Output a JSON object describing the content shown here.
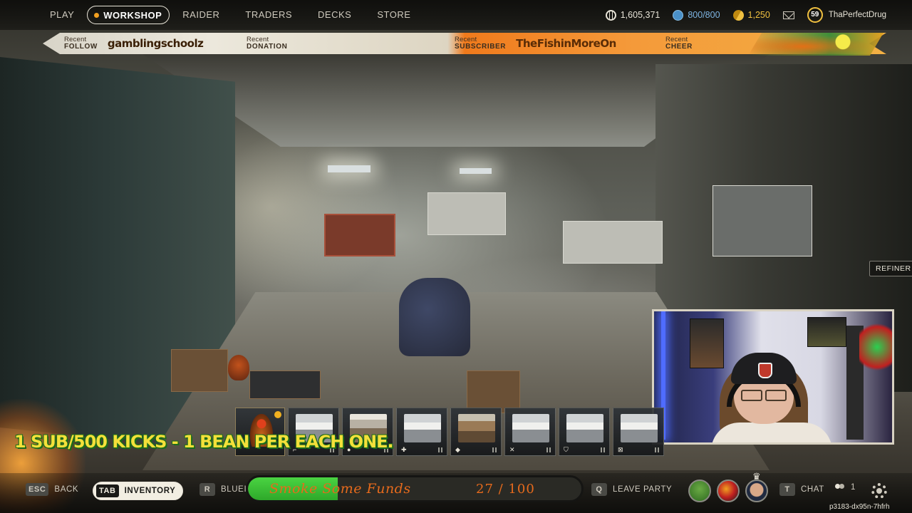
{
  "nav": {
    "items": [
      {
        "label": "PLAY",
        "active": false
      },
      {
        "label": "WORKSHOP",
        "active": true
      },
      {
        "label": "RAIDER",
        "active": false
      },
      {
        "label": "TRADERS",
        "active": false
      },
      {
        "label": "DECKS",
        "active": false
      },
      {
        "label": "STORE",
        "active": false
      }
    ]
  },
  "currencies": {
    "coins": "1,605,371",
    "seeds": "800/800",
    "credits": "1,250"
  },
  "profile": {
    "level": "59",
    "username": "ThaPerfectDrug"
  },
  "banner": {
    "follow_label_top": "Recent",
    "follow_label": "FOLLOW",
    "follow_name": "gamblingschoolz",
    "donation_label_top": "Recent",
    "donation_label": "DONATION",
    "subscriber_label_top": "Recent",
    "subscriber_label": "SUBSCRIBER",
    "subscriber_name": "TheFishinMoreOn",
    "cheer_label_top": "Recent",
    "cheer_label": "CHEER"
  },
  "world": {
    "station_tag": "REFINER"
  },
  "items": [
    {
      "icon": "rooster",
      "badge": "",
      "star": true
    },
    {
      "icon": "bench",
      "badge": "⌐",
      "star": false
    },
    {
      "icon": "lab",
      "badge": "●",
      "star": false
    },
    {
      "icon": "bench",
      "badge": "✚",
      "star": false
    },
    {
      "icon": "wood",
      "badge": "◆",
      "star": false
    },
    {
      "icon": "bench",
      "badge": "✕",
      "star": false
    },
    {
      "icon": "bench",
      "badge": "⛉",
      "star": false
    },
    {
      "icon": "bench",
      "badge": "⊠",
      "star": false
    }
  ],
  "promo_text": "1 SUB/500 KICKS - 1 BEAN PER EACH ONE.",
  "bottom": {
    "back_key": "ESC",
    "back_label": "BACK",
    "inventory_key": "TAB",
    "inventory_label": "INVENTORY",
    "blueprints_key": "R",
    "blueprints_label": "BLUEI",
    "leave_key": "Q",
    "leave_label": "LEAVE PARTY",
    "chat_key": "T",
    "chat_label": "CHAT",
    "party_count": "1"
  },
  "goal": {
    "title": "Smoke Some Funds",
    "count_text": "27 / 100",
    "current": 27,
    "target": 100
  },
  "session_id": "p3183-dx95n-7hfrh",
  "colors": {
    "accent_gold": "#f0c040",
    "accent_blue": "#7fb6e4",
    "goal_green": "#3ac038",
    "goal_text": "#e66a1c",
    "promo_yellow": "#f4e03a"
  }
}
